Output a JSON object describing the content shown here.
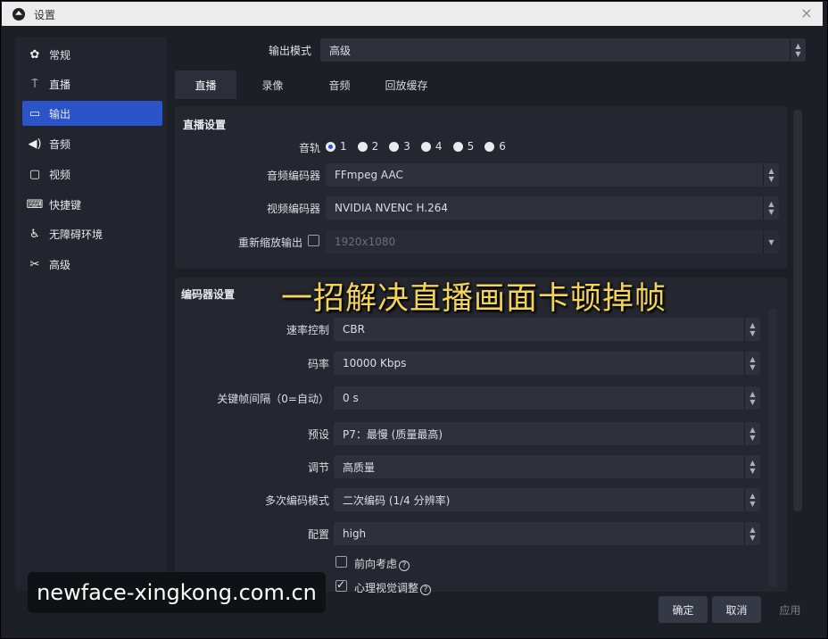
{
  "window": {
    "title": "设置",
    "close_glyph": "×"
  },
  "sidebar": {
    "items": [
      {
        "label": "常规",
        "icon": "gear-icon",
        "glyph": "✿"
      },
      {
        "label": "直播",
        "icon": "antenna-icon",
        "glyph": "⍑"
      },
      {
        "label": "输出",
        "icon": "output-icon",
        "glyph": "▭"
      },
      {
        "label": "音频",
        "icon": "speaker-icon",
        "glyph": "◀)"
      },
      {
        "label": "视频",
        "icon": "monitor-icon",
        "glyph": "▢"
      },
      {
        "label": "快捷键",
        "icon": "keyboard-icon",
        "glyph": "⌨"
      },
      {
        "label": "无障碍环境",
        "icon": "accessibility-icon",
        "glyph": "♿"
      },
      {
        "label": "高级",
        "icon": "wrench-icon",
        "glyph": "✂"
      }
    ],
    "active_index": 2
  },
  "output_mode": {
    "label": "输出模式",
    "value": "高级"
  },
  "tabs": [
    {
      "label": "直播"
    },
    {
      "label": "录像"
    },
    {
      "label": "音频"
    },
    {
      "label": "回放缓存"
    }
  ],
  "stream_settings": {
    "title": "直播设置",
    "track_label": "音轨",
    "tracks": [
      "1",
      "2",
      "3",
      "4",
      "5",
      "6"
    ],
    "selected_track": "1",
    "audio_encoder_label": "音频编码器",
    "audio_encoder": "FFmpeg AAC",
    "video_encoder_label": "视频编码器",
    "video_encoder": "NVIDIA NVENC H.264",
    "rescale_label": "重新缩放输出",
    "rescale_value": "1920x1080"
  },
  "encoder_settings": {
    "title": "编码器设置",
    "rate_control_label": "速率控制",
    "rate_control": "CBR",
    "bitrate_label": "码率",
    "bitrate": "10000 Kbps",
    "keyframe_label": "关键帧间隔（0=自动）",
    "keyframe": "0 s",
    "preset_label": "预设",
    "preset": "P7：最慢 (质量最高)",
    "tuning_label": "调节",
    "tuning": "高质量",
    "multipass_label": "多次编码模式",
    "multipass": "二次编码 (1/4 分辨率)",
    "profile_label": "配置",
    "profile": "high",
    "lookahead_label": "前向考虑",
    "psycho_label": "心理视觉调整",
    "help_glyph": "?"
  },
  "overlay_caption": "一招解决直播画面卡顿掉帧",
  "watermark": "newface-xingkong.com.cn",
  "footer": {
    "ok": "确定",
    "cancel": "取消",
    "apply": "应用"
  },
  "colors": {
    "accent": "#2b54c9",
    "caption": "#f3d35a",
    "background": "#1d1f26"
  }
}
